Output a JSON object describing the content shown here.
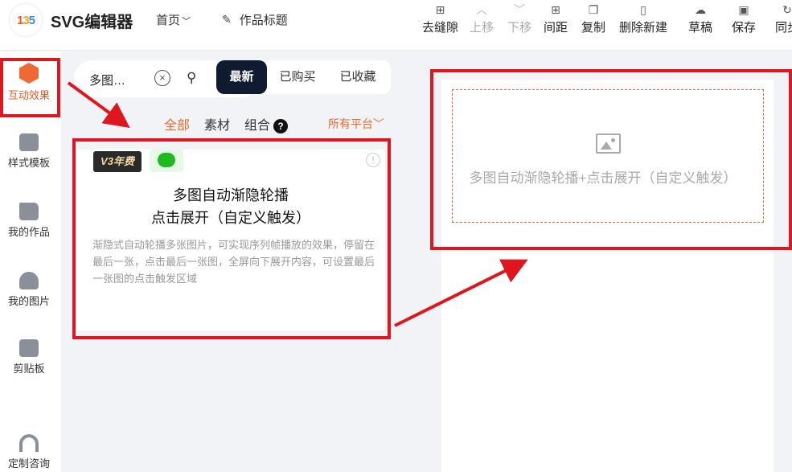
{
  "app": {
    "logo_text": [
      "1",
      "3",
      "5"
    ],
    "title": "SVG编辑器",
    "home_menu": "首页",
    "work_title": "作品标题"
  },
  "toolbar": [
    {
      "label": "去缝隙",
      "icon": "grid-icon",
      "disabled": false
    },
    {
      "label": "上移",
      "icon": "chevron-up-icon",
      "disabled": true
    },
    {
      "label": "下移",
      "icon": "chevron-down-icon",
      "disabled": true
    },
    {
      "label": "间距",
      "icon": "spacing-icon",
      "disabled": false
    },
    {
      "label": "复制",
      "icon": "copy-icon",
      "disabled": false
    },
    {
      "label": "删除新建",
      "icon": "trash-icon",
      "disabled": false
    },
    {
      "label": "草稿",
      "icon": "cloud-icon",
      "disabled": false
    },
    {
      "label": "保存",
      "icon": "save-icon",
      "disabled": false
    },
    {
      "label": "同步",
      "icon": "sync-icon",
      "disabled": false
    }
  ],
  "rail": [
    {
      "label": "互动效果",
      "active": true
    },
    {
      "label": "样式模板"
    },
    {
      "label": "我的作品"
    },
    {
      "label": "我的图片"
    },
    {
      "label": "剪贴板"
    },
    {
      "label": "定制咨询"
    }
  ],
  "search": {
    "value": "多图…"
  },
  "tabs": {
    "new": "最新",
    "bought": "已购买",
    "fav": "已收藏"
  },
  "filters": {
    "all": "全部",
    "material": "素材",
    "combo": "组合",
    "help": "?",
    "platform": "所有平台"
  },
  "card": {
    "badge": "V3年费",
    "title_line1": "多图自动渐隐轮播",
    "title_line2": "点击展开（自定义触发）",
    "description": "渐隐式自动轮播多张图片，可实现序列帧播放的效果，停留在最后一张，点击最后一张图，全屏向下展开内容，可设置最后一张图的点击触发区域"
  },
  "canvas": {
    "placeholder": "多图自动渐隐轮播+点击展开（自定义触发）"
  },
  "colors": {
    "accent": "#e86b2e",
    "annotation": "#e0161e",
    "dark": "#0f1b30"
  }
}
